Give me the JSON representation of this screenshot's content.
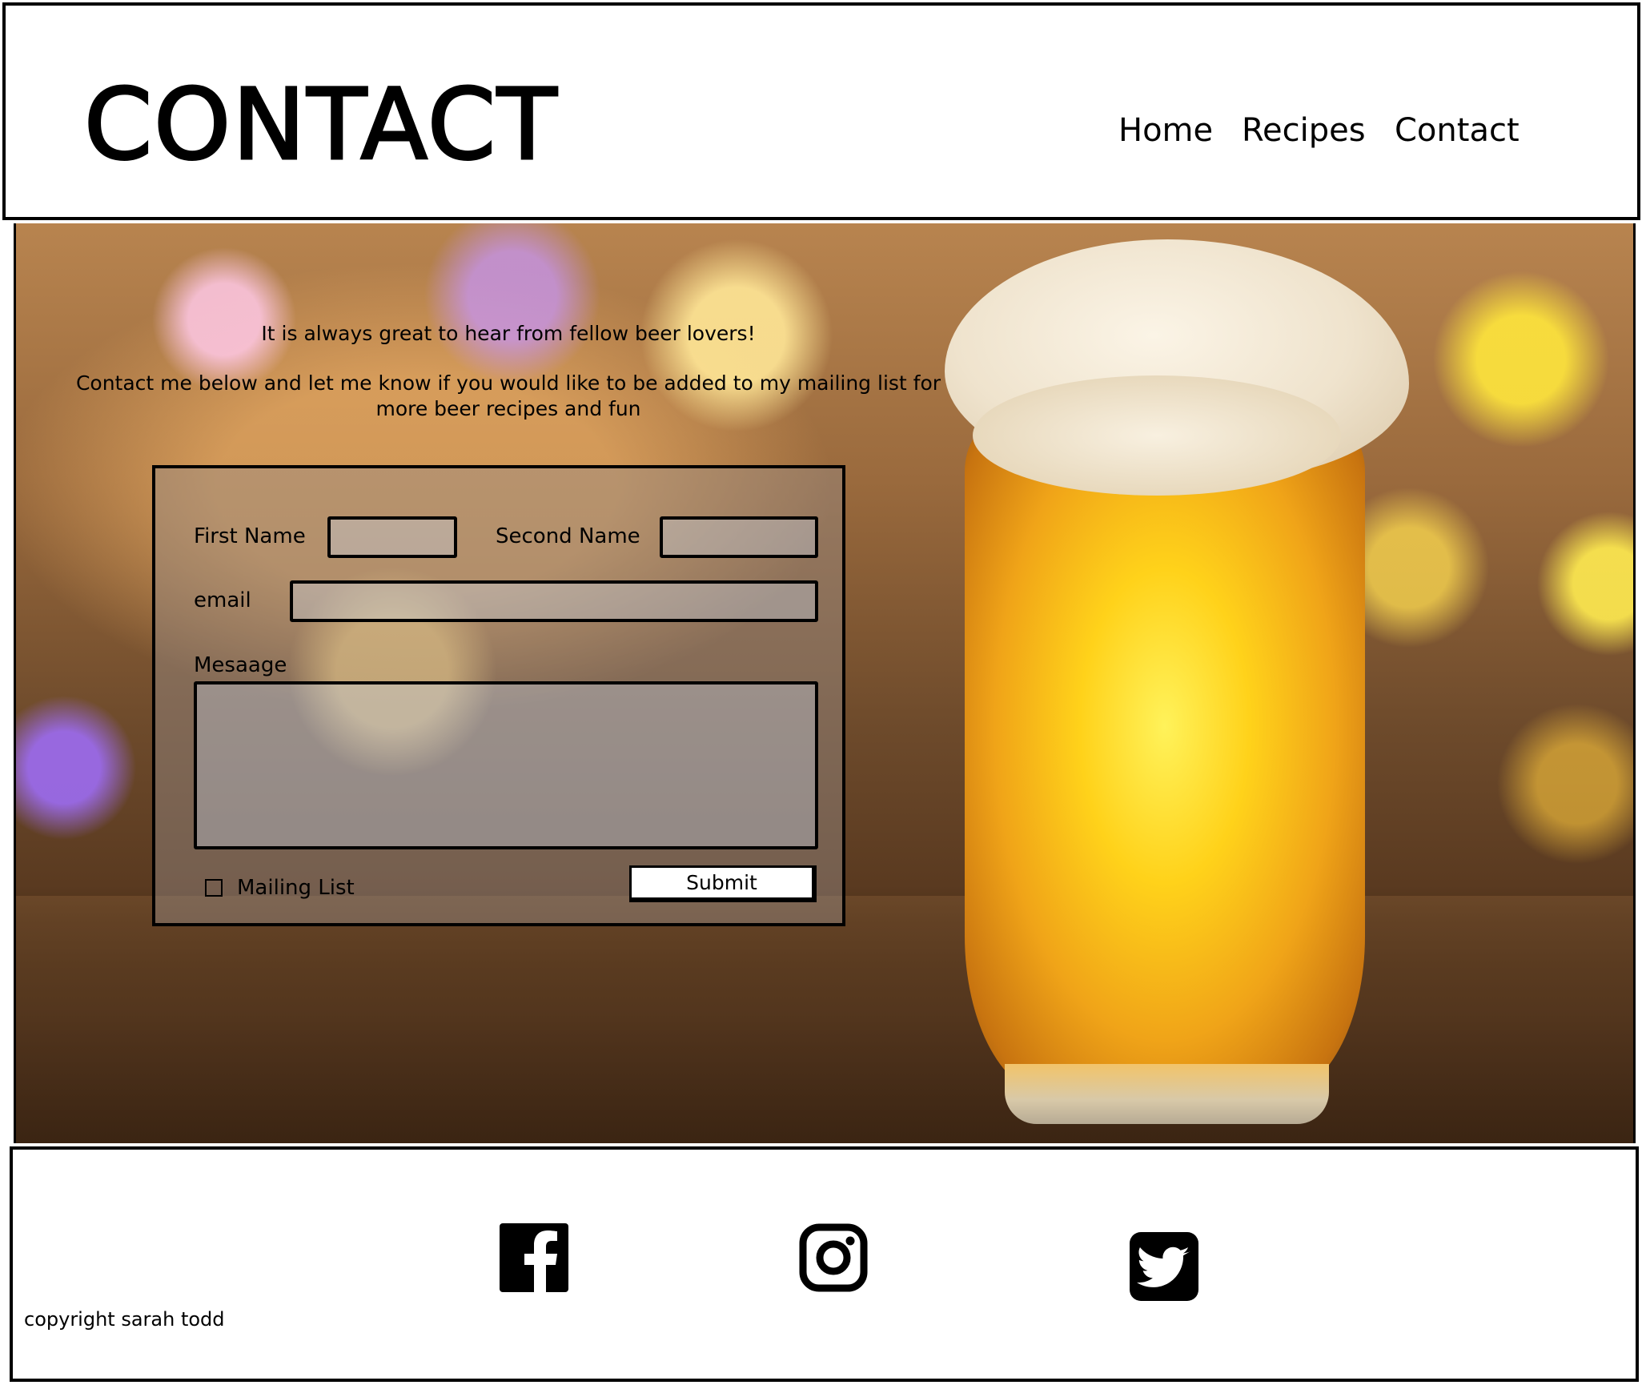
{
  "header": {
    "title": "CONTACT",
    "nav": [
      "Home",
      "Recipes",
      "Contact"
    ]
  },
  "hero": {
    "intro_line1": "It is always great to hear from fellow beer lovers!",
    "intro_line2": "Contact me below and let me know if you would like to be added to my mailing list for more beer recipes and fun"
  },
  "form": {
    "first_name_label": "First Name",
    "first_name_value": "",
    "second_name_label": "Second Name",
    "second_name_value": "",
    "email_label": "email",
    "email_value": "",
    "message_label": "Mesaage",
    "message_value": "",
    "mailing_list_label": "Mailing List",
    "mailing_list_checked": false,
    "submit_label": "Submit"
  },
  "footer": {
    "copyright": "copyright sarah todd",
    "social_icons": [
      "facebook-icon",
      "instagram-icon",
      "twitter-icon"
    ]
  }
}
